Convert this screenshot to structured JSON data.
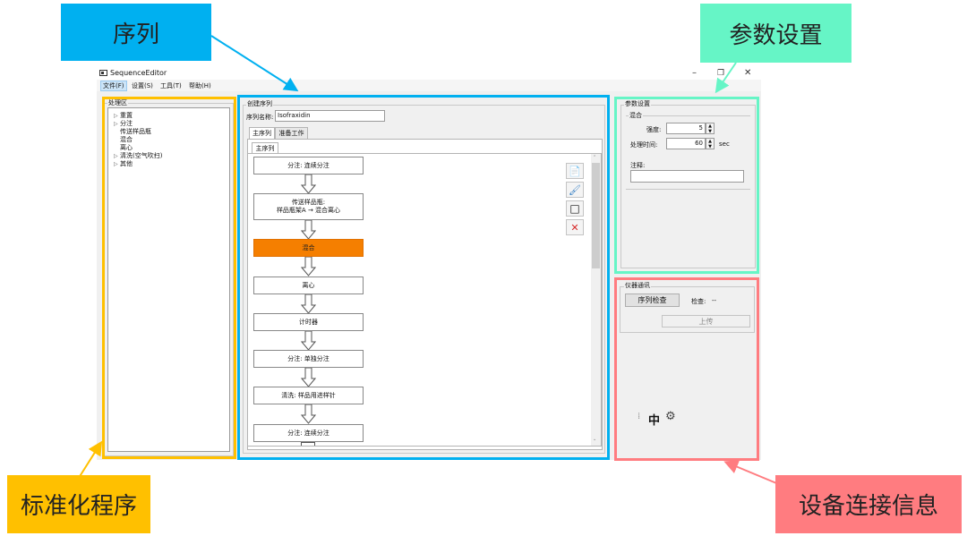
{
  "window": {
    "title": "SequenceEditor",
    "controls": {
      "minimize": "–",
      "restore": "❐",
      "close": "✕"
    }
  },
  "menu": [
    "文件(F)",
    "设置(S)",
    "工具(T)",
    "帮助(H)"
  ],
  "process_area": {
    "label": "处理区",
    "items": [
      {
        "label": "重置",
        "expandable": true
      },
      {
        "label": "分注",
        "expandable": true
      },
      {
        "label": "传送样品瓶",
        "expandable": false
      },
      {
        "label": "混合",
        "expandable": false
      },
      {
        "label": "离心",
        "expandable": false
      },
      {
        "label": "清洗(空气吹扫)",
        "expandable": true
      },
      {
        "label": "其他",
        "expandable": true
      }
    ]
  },
  "sequence": {
    "group_label": "创建序列",
    "name_label": "序列名称:",
    "name_value": "Isofraxidin",
    "tabs": [
      "主序列",
      "准备工作"
    ],
    "inner_tab": "主序列",
    "steps": [
      {
        "label": "分注: 连续分注",
        "active": false
      },
      {
        "label": "传送样品瓶:",
        "sub": "样品瓶架A → 混合离心",
        "active": false
      },
      {
        "label": "混合",
        "active": true
      },
      {
        "label": "离心",
        "active": false
      },
      {
        "label": "计时器",
        "active": false
      },
      {
        "label": "分注: 单独分注",
        "active": false
      },
      {
        "label": "清洗: 样品用进样针",
        "active": false
      },
      {
        "label": "分注: 连续分注",
        "active": false
      }
    ],
    "tool_icons": [
      "copy-icon",
      "brush-icon",
      "square-icon",
      "delete-icon"
    ],
    "tool_glyphs": [
      "📄",
      "🖌",
      "□",
      "✕"
    ]
  },
  "params": {
    "group_label": "参数设置",
    "sub_label": "混合",
    "intensity_label": "强度:",
    "intensity_value": "5",
    "time_label": "处理时间:",
    "time_value": "60",
    "time_unit": "sec",
    "note_label": "注释:",
    "note_value": ""
  },
  "comm": {
    "group_label": "仪器通讯",
    "check_button": "序列检查",
    "check_label": "检查:",
    "check_value": "--",
    "upload_button": "上传",
    "ime_mode": "中",
    "ime_separator": "⁞",
    "gear_glyph": "⚙"
  },
  "callouts": {
    "sequence": "序列",
    "params": "参数设置",
    "standard": "标准化程序",
    "device": "设备连接信息"
  },
  "colors": {
    "sequence": "#00b0f0",
    "params": "#66f5c6",
    "standard": "#ffc000",
    "device": "#ff7c80",
    "active_step": "#f57f00"
  }
}
